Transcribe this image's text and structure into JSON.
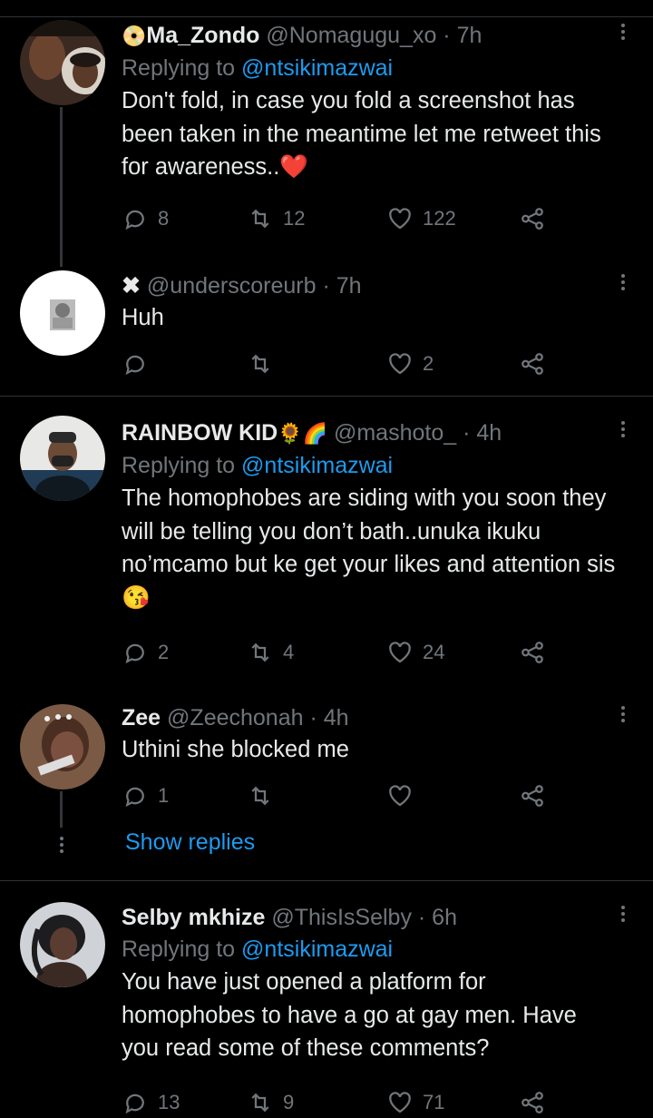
{
  "tweets": [
    {
      "name": "Ma_Zondo",
      "name_emoji": "📀",
      "handle": "@Nomagugu_xo",
      "time": "7h",
      "replying_prefix": "Replying to",
      "replying_handle": "@ntsikimazwai",
      "text": "Don't fold, in case you fold a screenshot has been taken in the meantime let me retweet this for awareness..❤️",
      "replies": "8",
      "retweets": "12",
      "likes": "122"
    },
    {
      "name": "",
      "name_emoji": "✖",
      "handle": "@underscoreurb",
      "time": "7h",
      "text": "Huh",
      "replies": "",
      "retweets": "",
      "likes": "2"
    },
    {
      "name": "RAINBOW KID",
      "name_emoji": "🌻🌈",
      "handle": "@mashoto_",
      "time": "4h",
      "replying_prefix": "Replying to",
      "replying_handle": "@ntsikimazwai",
      "text": "The homophobes are siding with you soon they will be telling you don’t bath..unuka ikuku no’mcamo but ke get your likes and attention sis😘",
      "replies": "2",
      "retweets": "4",
      "likes": "24"
    },
    {
      "name": "Zee",
      "name_emoji": "",
      "handle": "@Zeechonah",
      "time": "4h",
      "text": "Uthini she blocked me",
      "replies": "1",
      "retweets": "",
      "likes": ""
    },
    {
      "name": "Selby mkhize",
      "name_emoji": "",
      "handle": "@ThisIsSelby",
      "time": "6h",
      "replying_prefix": "Replying to",
      "replying_handle": "@ntsikimazwai",
      "text": "You have just opened a platform for homophobes to have a go at gay men. Have you read some of these comments?",
      "replies": "13",
      "retweets": "9",
      "likes": "71"
    }
  ],
  "show_replies": "Show replies",
  "colors": {
    "background": "#000000",
    "text": "#e7e9ea",
    "muted": "#71767b",
    "link": "#1d9bf0",
    "divider": "#2f3336"
  }
}
